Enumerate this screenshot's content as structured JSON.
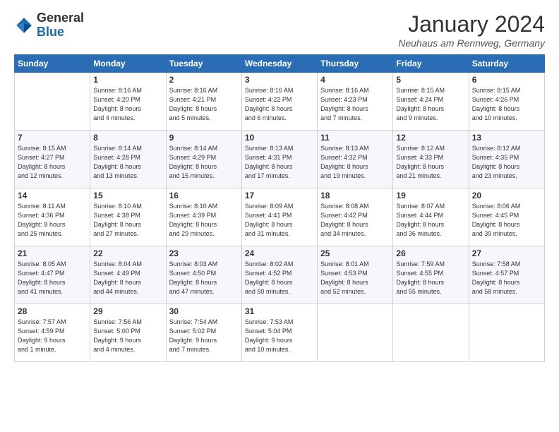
{
  "logo": {
    "general": "General",
    "blue": "Blue"
  },
  "header": {
    "month": "January 2024",
    "location": "Neuhaus am Rennweg, Germany"
  },
  "weekdays": [
    "Sunday",
    "Monday",
    "Tuesday",
    "Wednesday",
    "Thursday",
    "Friday",
    "Saturday"
  ],
  "weeks": [
    [
      {
        "day": "",
        "info": ""
      },
      {
        "day": "1",
        "info": "Sunrise: 8:16 AM\nSunset: 4:20 PM\nDaylight: 8 hours\nand 4 minutes."
      },
      {
        "day": "2",
        "info": "Sunrise: 8:16 AM\nSunset: 4:21 PM\nDaylight: 8 hours\nand 5 minutes."
      },
      {
        "day": "3",
        "info": "Sunrise: 8:16 AM\nSunset: 4:22 PM\nDaylight: 8 hours\nand 6 minutes."
      },
      {
        "day": "4",
        "info": "Sunrise: 8:16 AM\nSunset: 4:23 PM\nDaylight: 8 hours\nand 7 minutes."
      },
      {
        "day": "5",
        "info": "Sunrise: 8:15 AM\nSunset: 4:24 PM\nDaylight: 8 hours\nand 9 minutes."
      },
      {
        "day": "6",
        "info": "Sunrise: 8:15 AM\nSunset: 4:26 PM\nDaylight: 8 hours\nand 10 minutes."
      }
    ],
    [
      {
        "day": "7",
        "info": "Sunrise: 8:15 AM\nSunset: 4:27 PM\nDaylight: 8 hours\nand 12 minutes."
      },
      {
        "day": "8",
        "info": "Sunrise: 8:14 AM\nSunset: 4:28 PM\nDaylight: 8 hours\nand 13 minutes."
      },
      {
        "day": "9",
        "info": "Sunrise: 8:14 AM\nSunset: 4:29 PM\nDaylight: 8 hours\nand 15 minutes."
      },
      {
        "day": "10",
        "info": "Sunrise: 8:13 AM\nSunset: 4:31 PM\nDaylight: 8 hours\nand 17 minutes."
      },
      {
        "day": "11",
        "info": "Sunrise: 8:13 AM\nSunset: 4:32 PM\nDaylight: 8 hours\nand 19 minutes."
      },
      {
        "day": "12",
        "info": "Sunrise: 8:12 AM\nSunset: 4:33 PM\nDaylight: 8 hours\nand 21 minutes."
      },
      {
        "day": "13",
        "info": "Sunrise: 8:12 AM\nSunset: 4:35 PM\nDaylight: 8 hours\nand 23 minutes."
      }
    ],
    [
      {
        "day": "14",
        "info": "Sunrise: 8:11 AM\nSunset: 4:36 PM\nDaylight: 8 hours\nand 25 minutes."
      },
      {
        "day": "15",
        "info": "Sunrise: 8:10 AM\nSunset: 4:38 PM\nDaylight: 8 hours\nand 27 minutes."
      },
      {
        "day": "16",
        "info": "Sunrise: 8:10 AM\nSunset: 4:39 PM\nDaylight: 8 hours\nand 29 minutes."
      },
      {
        "day": "17",
        "info": "Sunrise: 8:09 AM\nSunset: 4:41 PM\nDaylight: 8 hours\nand 31 minutes."
      },
      {
        "day": "18",
        "info": "Sunrise: 8:08 AM\nSunset: 4:42 PM\nDaylight: 8 hours\nand 34 minutes."
      },
      {
        "day": "19",
        "info": "Sunrise: 8:07 AM\nSunset: 4:44 PM\nDaylight: 8 hours\nand 36 minutes."
      },
      {
        "day": "20",
        "info": "Sunrise: 8:06 AM\nSunset: 4:45 PM\nDaylight: 8 hours\nand 39 minutes."
      }
    ],
    [
      {
        "day": "21",
        "info": "Sunrise: 8:05 AM\nSunset: 4:47 PM\nDaylight: 8 hours\nand 41 minutes."
      },
      {
        "day": "22",
        "info": "Sunrise: 8:04 AM\nSunset: 4:49 PM\nDaylight: 8 hours\nand 44 minutes."
      },
      {
        "day": "23",
        "info": "Sunrise: 8:03 AM\nSunset: 4:50 PM\nDaylight: 8 hours\nand 47 minutes."
      },
      {
        "day": "24",
        "info": "Sunrise: 8:02 AM\nSunset: 4:52 PM\nDaylight: 8 hours\nand 50 minutes."
      },
      {
        "day": "25",
        "info": "Sunrise: 8:01 AM\nSunset: 4:53 PM\nDaylight: 8 hours\nand 52 minutes."
      },
      {
        "day": "26",
        "info": "Sunrise: 7:59 AM\nSunset: 4:55 PM\nDaylight: 8 hours\nand 55 minutes."
      },
      {
        "day": "27",
        "info": "Sunrise: 7:58 AM\nSunset: 4:57 PM\nDaylight: 8 hours\nand 58 minutes."
      }
    ],
    [
      {
        "day": "28",
        "info": "Sunrise: 7:57 AM\nSunset: 4:59 PM\nDaylight: 9 hours\nand 1 minute."
      },
      {
        "day": "29",
        "info": "Sunrise: 7:56 AM\nSunset: 5:00 PM\nDaylight: 9 hours\nand 4 minutes."
      },
      {
        "day": "30",
        "info": "Sunrise: 7:54 AM\nSunset: 5:02 PM\nDaylight: 9 hours\nand 7 minutes."
      },
      {
        "day": "31",
        "info": "Sunrise: 7:53 AM\nSunset: 5:04 PM\nDaylight: 9 hours\nand 10 minutes."
      },
      {
        "day": "",
        "info": ""
      },
      {
        "day": "",
        "info": ""
      },
      {
        "day": "",
        "info": ""
      }
    ]
  ]
}
